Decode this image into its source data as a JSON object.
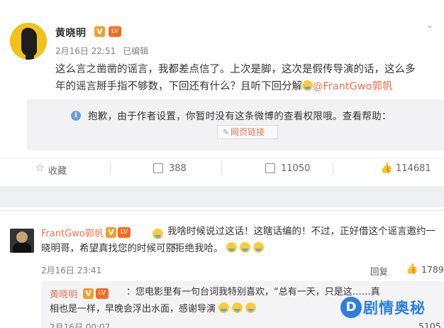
{
  "post": {
    "author": "黄晓明",
    "badge_v": "V",
    "level_badge": "LV",
    "timestamp": "2月16日 22:51",
    "edited": "已编辑",
    "text_part1": "这么言之凿凿的谣言，我都差点信了。上次是脚，这次是假传导演的话，这么多",
    "text_part2": "年的谣言掰手指不够数，下回还有什么？且听下回分解",
    "mention": "@FrantGwo郭帆"
  },
  "notice": {
    "text": "抱歉，由于作者设置，你暂时没有这条微博的查看权限哦。查看帮助：",
    "link_label": "网页链接"
  },
  "actions": {
    "favorite_label": "收藏",
    "repost_count": "388",
    "comment_count": "11050",
    "like_count": "114681"
  },
  "comments": [
    {
      "name": "FrantGwo郭帆",
      "text_line1": "我啥时候说过这话！这瞎话编的！不过，正好借这个谣言邀约一下",
      "text_line2": "晓明哥，希望真找您的时候可别拒绝我哈。",
      "time": "2月16日 23:41",
      "reply_label": "回复",
      "like_count": "1789"
    },
    {
      "name": "黄晓明",
      "text_line1": "：您电影里有一句台词我特别喜欢，“总有一天，只是这……真",
      "text_line2": "相也是一样，早晚会浮出水面，感谢导演",
      "time": "2月16日 00:07",
      "like_count": "5105"
    }
  ],
  "watermark": {
    "logo_letter": "D",
    "text": "剧情奥秘"
  },
  "colors": {
    "accent": "#eb7350",
    "badge": "#f59d2a",
    "watermark": "#2d7fe0"
  }
}
